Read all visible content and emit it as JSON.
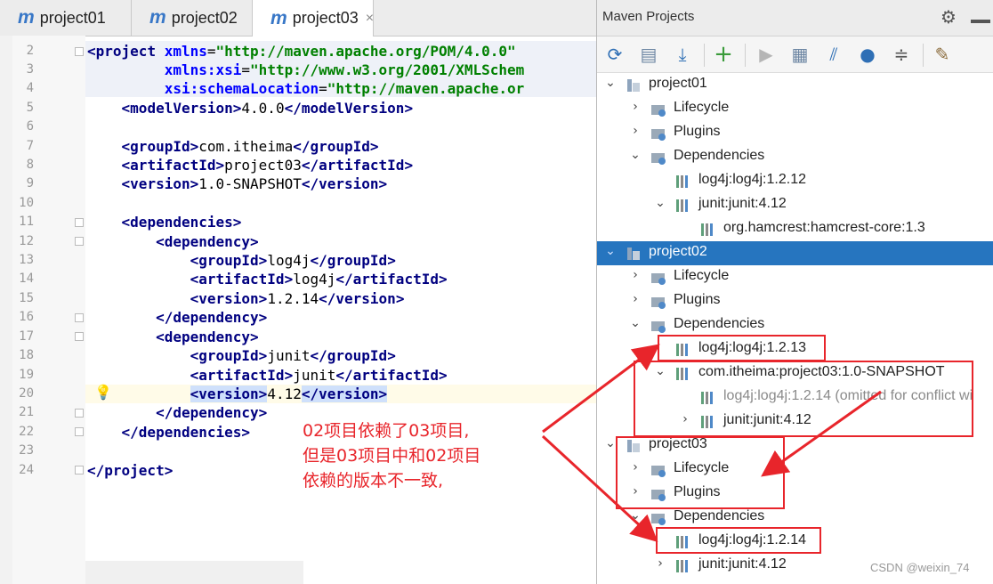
{
  "editor": {
    "tabs": [
      {
        "label": "project01",
        "icon": "m"
      },
      {
        "label": "project02",
        "icon": "m"
      },
      {
        "label": "project03",
        "icon": "m",
        "close": "×"
      }
    ],
    "line_numbers": [
      "2",
      "3",
      "4",
      "5",
      "6",
      "7",
      "8",
      "9",
      "10",
      "11",
      "12",
      "13",
      "14",
      "15",
      "16",
      "17",
      "18",
      "19",
      "20",
      "21",
      "22",
      "23",
      "24"
    ],
    "code": {
      "l2_open": "<",
      "l2_tag": "project",
      "l2_attr": " xmlns",
      "l2_eq": "=",
      "l2_val": "\"http://maven.apache.org/POM/4.0.0\"",
      "l3_attr": "xmlns:xsi",
      "l3_val": "\"http://www.w3.org/2001/XMLSchem",
      "l4_attr": "xsi:schemaLocation",
      "l4_val": "\"http://maven.apache.or",
      "model_open": "modelVersion",
      "model_val": "4.0.0",
      "group_tag": "groupId",
      "group_val": "com.itheima",
      "artifact_tag": "artifactId",
      "artifact_val": "project03",
      "version_tag": "version",
      "version_val": "1.0-SNAPSHOT",
      "dependencies_tag": "dependencies",
      "dependency_tag": "dependency",
      "dep1_group": "log4j",
      "dep1_artifact": "log4j",
      "dep1_version": "1.2.14",
      "dep2_group": "junit",
      "dep2_artifact": "junit",
      "dep2_version": "4.12",
      "project_tag": "project"
    }
  },
  "maven": {
    "title": "Maven Projects",
    "toolbar_icons": [
      "reimport-icon",
      "generate-sources-icon",
      "download-icon",
      "add-icon",
      "run-icon",
      "execute-goal-icon",
      "toggle-offline-icon",
      "skip-tests-icon",
      "collapse-icon",
      "settings-icon"
    ],
    "tree": [
      {
        "label": "project01",
        "type": "project",
        "arrow": "⌄"
      },
      {
        "label": "Lifecycle",
        "type": "folder",
        "arrow": "›"
      },
      {
        "label": "Plugins",
        "type": "folder",
        "arrow": "›"
      },
      {
        "label": "Dependencies",
        "type": "folder",
        "arrow": "⌄"
      },
      {
        "label": "log4j:log4j:1.2.12",
        "type": "dep",
        "arrow": ""
      },
      {
        "label": "junit:junit:4.12",
        "type": "dep",
        "arrow": "⌄"
      },
      {
        "label": "org.hamcrest:hamcrest-core:1.3",
        "type": "dep",
        "arrow": ""
      },
      {
        "label": "project02",
        "type": "project",
        "arrow": "⌄"
      },
      {
        "label": "Lifecycle",
        "type": "folder",
        "arrow": "›"
      },
      {
        "label": "Plugins",
        "type": "folder",
        "arrow": "›"
      },
      {
        "label": "Dependencies",
        "type": "folder",
        "arrow": "⌄"
      },
      {
        "label": "log4j:log4j:1.2.13",
        "type": "dep",
        "arrow": ""
      },
      {
        "label": "com.itheima:project03:1.0-SNAPSHOT",
        "type": "dep",
        "arrow": "⌄"
      },
      {
        "label": "log4j:log4j:1.2.14 (omitted for conflict wi",
        "type": "dep-grey",
        "arrow": ""
      },
      {
        "label": "junit:junit:4.12",
        "type": "dep",
        "arrow": "›"
      },
      {
        "label": "project03",
        "type": "project",
        "arrow": "⌄"
      },
      {
        "label": "Lifecycle",
        "type": "folder",
        "arrow": "›"
      },
      {
        "label": "Plugins",
        "type": "folder",
        "arrow": "›"
      },
      {
        "label": "Dependencies",
        "type": "folder",
        "arrow": "⌄"
      },
      {
        "label": "log4j:log4j:1.2.14",
        "type": "dep",
        "arrow": ""
      },
      {
        "label": "junit:junit:4.12",
        "type": "dep",
        "arrow": "›"
      }
    ]
  },
  "annotation": {
    "line1": "02项目依赖了03项目,",
    "line2": "但是03项目中和02项目",
    "line3": "依赖的版本不一致,"
  },
  "watermark": "CSDN @weixin_74",
  "colors": {
    "selection": "#2675bf",
    "annotation_red": "#e8252b",
    "tag_blue": "#000080",
    "attr_blue": "#0000ff",
    "string_green": "#008000"
  }
}
